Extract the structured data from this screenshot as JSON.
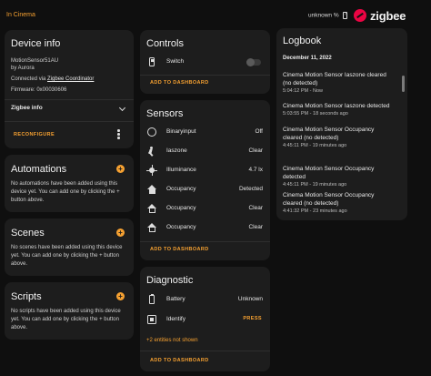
{
  "topbar": {
    "area": "In Cinema",
    "battery_text": "unknown %",
    "brand": "zigbee"
  },
  "device_info": {
    "title": "Device info",
    "model": "MotionSensor51AU",
    "manufacturer": "by Aurora",
    "connected_prefix": "Connected via ",
    "connected_link": "Zigbee Coordinator",
    "firmware": "Firmware: 0x00030606",
    "zigbee_info": "Zigbee info",
    "reconfigure": "RECONFIGURE"
  },
  "automations": {
    "title": "Automations",
    "text": "No automations have been added using this device yet. You can add one by clicking the + button above."
  },
  "scenes": {
    "title": "Scenes",
    "text": "No scenes have been added using this device yet. You can add one by clicking the + button above."
  },
  "scripts": {
    "title": "Scripts",
    "text": "No scripts have been added using this device yet. You can add one by clicking the + button above."
  },
  "controls": {
    "title": "Controls",
    "switch_label": "Switch",
    "add": "ADD TO DASHBOARD"
  },
  "sensors": {
    "title": "Sensors",
    "rows": [
      {
        "label": "Binaryinput",
        "value": "Off",
        "icon": "radio-off-icon"
      },
      {
        "label": "Iaszone",
        "value": "Clear",
        "icon": "motion-icon"
      },
      {
        "label": "Illuminance",
        "value": "4.7 lx",
        "icon": "brightness-icon"
      },
      {
        "label": "Occupancy",
        "value": "Detected",
        "icon": "home-icon"
      },
      {
        "label": "Occupancy",
        "value": "Clear",
        "icon": "home-outline-icon"
      },
      {
        "label": "Occupancy",
        "value": "Clear",
        "icon": "home-outline-icon"
      }
    ],
    "add": "ADD TO DASHBOARD"
  },
  "diagnostic": {
    "title": "Diagnostic",
    "rows": [
      {
        "label": "Battery",
        "value": "Unknown",
        "icon": "battery-unknown-icon"
      },
      {
        "label": "Identify",
        "value": "PRESS",
        "icon": "identify-icon"
      }
    ],
    "hidden": "+2 entities not shown",
    "add": "ADD TO DASHBOARD"
  },
  "logbook": {
    "title": "Logbook",
    "date": "December 11, 2022",
    "entries": [
      {
        "msg": "Cinema Motion Sensor Iaszone cleared (no detected)",
        "time": "5:04:12 PM - Now"
      },
      {
        "msg": "Cinema Motion Sensor Iaszone detected",
        "time": "5:03:55 PM - 18 seconds ago"
      },
      {
        "msg": "Cinema Motion Sensor Occupancy cleared (no detected)",
        "time": "4:45:11 PM - 19 minutes ago"
      },
      {
        "msg": "Cinema Motion Sensor Occupancy detected",
        "time": "4:45:11 PM - 19 minutes ago"
      },
      {
        "msg": "Cinema Motion Sensor Occupancy cleared (no detected)",
        "time": "4:41:32 PM - 23 minutes ago"
      }
    ]
  },
  "colors": {
    "accent": "#f6a131",
    "card": "#1d1d1d",
    "background": "#0f0f0f",
    "zigbee": "#eb0443"
  }
}
